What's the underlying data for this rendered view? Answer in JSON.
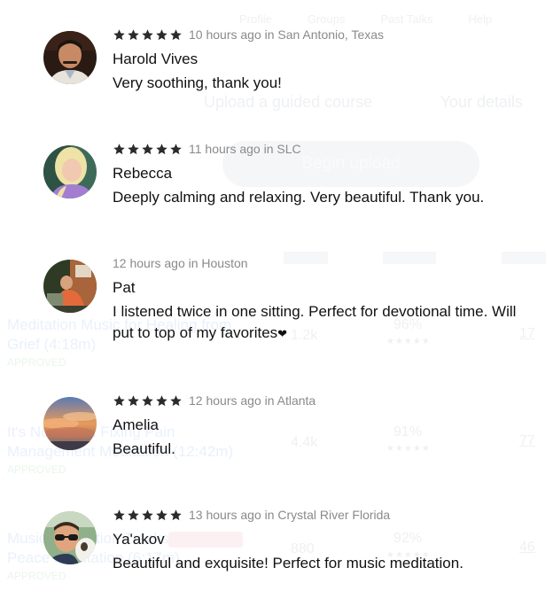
{
  "background": {
    "nav": [
      "Profile",
      "Groups",
      "Past Talks",
      "Help"
    ],
    "upload_tabs": [
      "Upload a guided course",
      "Your details"
    ],
    "begin_upload_label": "Begin upload",
    "rows": [
      {
        "title": "Meditation Music for Healing from Grief (4:18m)",
        "status": "APPROVED",
        "plays": "1.2k",
        "percent": "96%",
        "count": "17"
      },
      {
        "title": "It's Not About Fixing Pain Management Meditation (12:42m)",
        "status": "APPROVED",
        "plays": "4.4k",
        "percent": "91%",
        "count": "77"
      },
      {
        "title": "Music Meditation Tracks: Inner Peace Meditation (6:17m)",
        "status": "APPROVED",
        "plays": "880",
        "percent": "92%",
        "count": "46"
      }
    ]
  },
  "reviews": [
    {
      "rating": 5,
      "show_stars": true,
      "meta": "10 hours ago in San Antonio, Texas",
      "name": "Harold Vives",
      "comment": "Very soothing, thank you!",
      "avatar_icon": "man-portrait-avatar"
    },
    {
      "rating": 5,
      "show_stars": true,
      "meta": "11 hours ago in SLC",
      "name": "Rebecca",
      "comment": "Deeply calming and relaxing. Very beautiful. Thank you.",
      "avatar_icon": "woman-portrait-avatar"
    },
    {
      "rating": 0,
      "show_stars": false,
      "meta": "12 hours ago in Houston",
      "name": "Pat",
      "comment": "I listened twice in one sitting. Perfect for devotional time. Will put to top of my favorites",
      "comment_suffix": "❤",
      "avatar_icon": "person-sitting-avatar"
    },
    {
      "rating": 5,
      "show_stars": true,
      "meta": "12 hours ago in Atlanta",
      "name": "Amelia",
      "comment": "Beautiful.",
      "avatar_icon": "sunset-clouds-avatar"
    },
    {
      "rating": 5,
      "show_stars": true,
      "meta": "13 hours ago in Crystal River Florida",
      "name": "Ya'akov",
      "comment": "Beautiful and exquisite! Perfect for music meditation.",
      "avatar_icon": "man-with-dog-avatar"
    }
  ],
  "colors": {
    "star": "#2b2b2b",
    "meta_text": "#8a8a8a",
    "body_text": "#111111"
  }
}
